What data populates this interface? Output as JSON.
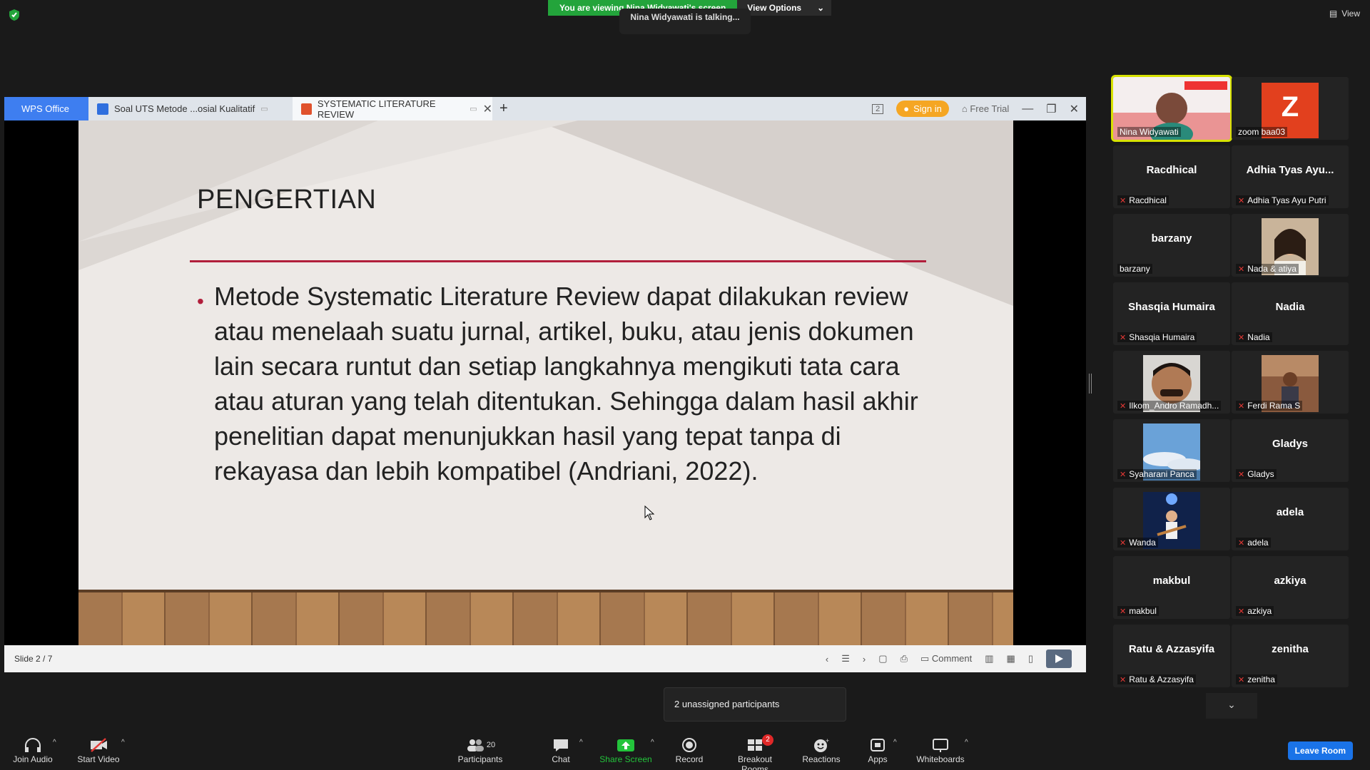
{
  "top": {
    "banner_text": "You are viewing Nina Widyawati's screen",
    "view_options": "View Options",
    "talking": "Nina Widyawati is talking...",
    "view_label": "View"
  },
  "wps": {
    "brand": "WPS Office",
    "tabs": [
      {
        "label": "Soal UTS Metode ...osial Kualitatif"
      },
      {
        "label": "SYSTEMATIC LITERATURE REVIEW"
      }
    ],
    "tab_count": "2",
    "sign_in": "Sign in",
    "free_trial": "Free Trial",
    "status_slide": "Slide 2 / 7",
    "comment": "Comment"
  },
  "slide": {
    "title": "PENGERTIAN",
    "body": "Metode Systematic Literature Review  dapat dilakukan review atau menelaah suatu jurnal, artikel, buku, atau jenis dokumen lain secara runtut dan setiap langkahnya mengikuti tata cara atau aturan yang telah ditentukan. Sehingga dalam hasil akhir penelitian dapat menunjukkan hasil yang tepat tanpa di rekayasa dan lebih kompatibel (Andriani, 2022)."
  },
  "gallery": [
    {
      "label": "Nina Widyawati"
    },
    {
      "label": "zoom baa03",
      "initial": "Z"
    },
    {
      "big": "Racdhical",
      "label": "Racdhical"
    },
    {
      "big": "Adhia Tyas Ayu...",
      "label": "Adhia Tyas Ayu Putri"
    },
    {
      "big": "barzany",
      "label": "barzany"
    },
    {
      "label": "Nada & atiya"
    },
    {
      "big": "Shasqia Humaira",
      "label": "Shasqia Humaira"
    },
    {
      "big": "Nadia",
      "label": "Nadia"
    },
    {
      "label": "Ilkom_Andro Ramadh..."
    },
    {
      "label": "Ferdi Rama S"
    },
    {
      "label": "Syaharani Panca"
    },
    {
      "big": "Gladys",
      "label": "Gladys"
    },
    {
      "label": "Wanda"
    },
    {
      "big": "adela",
      "label": "adela"
    },
    {
      "big": "makbul",
      "label": "makbul"
    },
    {
      "big": "azkiya",
      "label": "azkiya"
    },
    {
      "big": "Ratu & Azzasyifa",
      "label": "Ratu & Azzasyifa"
    },
    {
      "big": "zenitha",
      "label": "zenitha"
    }
  ],
  "unassigned": "2 unassigned participants",
  "toolbar": {
    "join_audio": "Join Audio",
    "start_video": "Start Video",
    "participants": "Participants",
    "participants_count": "20",
    "chat": "Chat",
    "share_screen": "Share Screen",
    "record": "Record",
    "breakout_rooms": "Breakout Rooms",
    "breakout_badge": "2",
    "reactions": "Reactions",
    "apps": "Apps",
    "whiteboards": "Whiteboards",
    "leave_room": "Leave Room"
  },
  "colors": {
    "accent_green": "#23a43b",
    "slide_accent": "#b11e3b",
    "wps_blue": "#3e7ef0",
    "leave_blue": "#1a73e8"
  }
}
